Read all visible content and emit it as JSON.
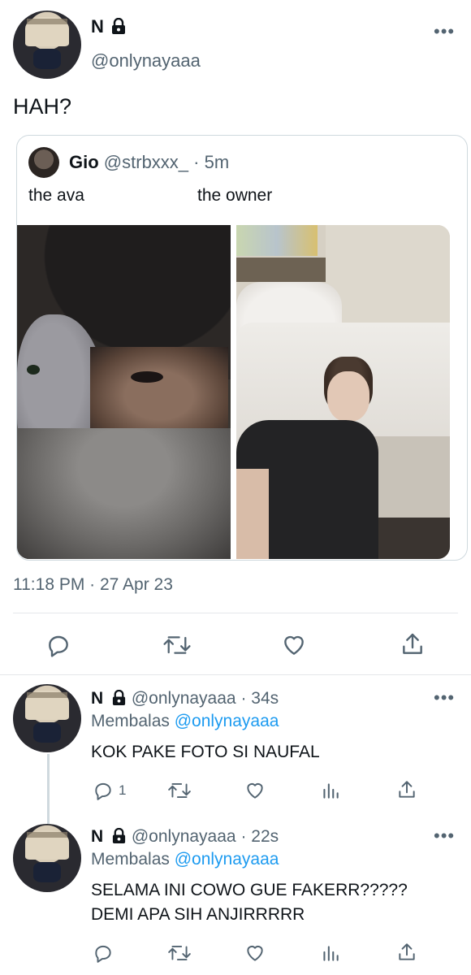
{
  "main_tweet": {
    "display_name": "N",
    "handle": "@onlynayaaa",
    "text": "HAH?",
    "timestamp": "11:18 PM · 27 Apr 23",
    "more": "•••"
  },
  "quoted_tweet": {
    "display_name": "Gio",
    "handle": "@strbxxx_",
    "time": "· 5m",
    "caption_left": "the ava",
    "caption_right": "the owner"
  },
  "replies": [
    {
      "display_name": "N",
      "handle": "@onlynayaaa",
      "time": "· 34s",
      "replying_label": "Membalas",
      "replying_to": "@onlynayaaa",
      "text": "KOK PAKE FOTO SI NAUFAL",
      "reply_count": "1"
    },
    {
      "display_name": "N",
      "handle": "@onlynayaaa",
      "time": "· 22s",
      "replying_label": "Membalas",
      "replying_to": "@onlynayaaa",
      "text_line1": "SELAMA INI COWO GUE FAKERR?????",
      "text_line2": "DEMI APA SIH ANJIRRRRR"
    }
  ],
  "icons": [
    "reply-icon",
    "retweet-icon",
    "like-icon",
    "share-icon",
    "analytics-icon",
    "lock-icon",
    "more-icon"
  ],
  "colors": {
    "link": "#1d9bf0",
    "secondary": "#536471",
    "text": "#0f1419"
  }
}
